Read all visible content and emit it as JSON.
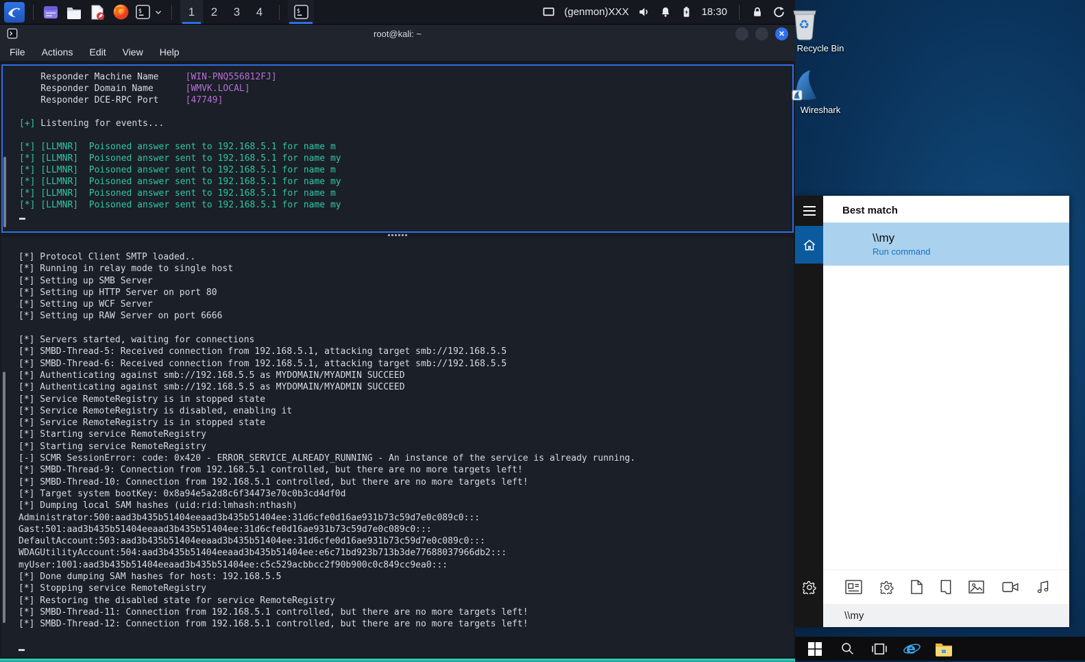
{
  "kali_panel": {
    "launchers": [
      "kali-menu-icon",
      "window-app-icon",
      "file-manager-icon",
      "text-editor-icon",
      "firefox-icon",
      "terminal-icon",
      "chevron-down-icon"
    ],
    "workspaces": {
      "labels": [
        "1",
        "2",
        "3",
        "4"
      ],
      "active_index": 0
    },
    "window_buttons": [
      "terminal-icon"
    ],
    "tray": {
      "genmon_label": "(genmon)XXX",
      "clock": "18:30",
      "icons": [
        "display-icon",
        "volume-icon",
        "bell-icon",
        "battery-icon",
        "lock-icon",
        "logout-icon"
      ]
    }
  },
  "terminal": {
    "title": "root@kali: ~",
    "menu": [
      "File",
      "Actions",
      "Edit",
      "View",
      "Help"
    ],
    "top_pane": {
      "lines": [
        [
          [
            "w",
            "    Responder Machine Name     "
          ],
          [
            "p",
            "[WIN-PNQ556812FJ]"
          ]
        ],
        [
          [
            "w",
            "    Responder Domain Name      "
          ],
          [
            "p",
            "[WMVK.LOCAL]"
          ]
        ],
        [
          [
            "w",
            "    Responder DCE-RPC Port     "
          ],
          [
            "p",
            "[47749]"
          ]
        ],
        [],
        [
          [
            "t",
            "[+]"
          ],
          [
            "w",
            " Listening for events..."
          ]
        ],
        [],
        [
          [
            "t",
            "[*] [LLMNR]  Poisoned answer sent to 192.168.5.1 for name m"
          ]
        ],
        [
          [
            "t",
            "[*] [LLMNR]  Poisoned answer sent to 192.168.5.1 for name my"
          ]
        ],
        [
          [
            "t",
            "[*] [LLMNR]  Poisoned answer sent to 192.168.5.1 for name m"
          ]
        ],
        [
          [
            "t",
            "[*] [LLMNR]  Poisoned answer sent to 192.168.5.1 for name my"
          ]
        ],
        [
          [
            "t",
            "[*] [LLMNR]  Poisoned answer sent to 192.168.5.1 for name m"
          ]
        ],
        [
          [
            "t",
            "[*] [LLMNR]  Poisoned answer sent to 192.168.5.1 for name my"
          ]
        ]
      ]
    },
    "bottom_pane": {
      "lines": [
        "[*] Protocol Client SMTP loaded..",
        "[*] Running in relay mode to single host",
        "[*] Setting up SMB Server",
        "[*] Setting up HTTP Server on port 80",
        "[*] Setting up WCF Server",
        "[*] Setting up RAW Server on port 6666",
        "",
        "[*] Servers started, waiting for connections",
        "[*] SMBD-Thread-5: Received connection from 192.168.5.1, attacking target smb://192.168.5.5",
        "[*] SMBD-Thread-6: Received connection from 192.168.5.1, attacking target smb://192.168.5.5",
        "[*] Authenticating against smb://192.168.5.5 as MYDOMAIN/MYADMIN SUCCEED",
        "[*] Authenticating against smb://192.168.5.5 as MYDOMAIN/MYADMIN SUCCEED",
        "[*] Service RemoteRegistry is in stopped state",
        "[*] Service RemoteRegistry is disabled, enabling it",
        "[*] Service RemoteRegistry is in stopped state",
        "[*] Starting service RemoteRegistry",
        "[*] Starting service RemoteRegistry",
        "[-] SCMR SessionError: code: 0x420 - ERROR_SERVICE_ALREADY_RUNNING - An instance of the service is already running.",
        "[*] SMBD-Thread-9: Connection from 192.168.5.1 controlled, but there are no more targets left!",
        "[*] SMBD-Thread-10: Connection from 192.168.5.1 controlled, but there are no more targets left!",
        "[*] Target system bootKey: 0x8a94e5a2d8c6f34473e70c0b3cd4df0d",
        "[*] Dumping local SAM hashes (uid:rid:lmhash:nthash)",
        "Administrator:500:aad3b435b51404eeaad3b435b51404ee:31d6cfe0d16ae931b73c59d7e0c089c0:::",
        "Gast:501:aad3b435b51404eeaad3b435b51404ee:31d6cfe0d16ae931b73c59d7e0c089c0:::",
        "DefaultAccount:503:aad3b435b51404eeaad3b435b51404ee:31d6cfe0d16ae931b73c59d7e0c089c0:::",
        "WDAGUtilityAccount:504:aad3b435b51404eeaad3b435b51404ee:e6c71bd923b713b3de77688037966db2:::",
        "myUser:1001:aad3b435b51404eeaad3b435b51404ee:c5c529acbbcc2f90b900c0c849cc9ea0:::",
        "[*] Done dumping SAM hashes for host: 192.168.5.5",
        "[*] Stopping service RemoteRegistry",
        "[*] Restoring the disabled state for service RemoteRegistry",
        "[*] SMBD-Thread-11: Connection from 192.168.5.1 controlled, but there are no more targets left!",
        "[*] SMBD-Thread-12: Connection from 192.168.5.1 controlled, but there are no more targets left!"
      ]
    }
  },
  "windows_desktop": {
    "icons": [
      {
        "label": "Recycle Bin",
        "icon": "recycle-bin-icon"
      },
      {
        "label": "Wireshark",
        "icon": "wireshark-icon"
      }
    ],
    "search_panel": {
      "rail_icons": [
        "hamburger-icon",
        "home-icon",
        "gear-icon"
      ],
      "best_match_label": "Best match",
      "result": {
        "title": "\\\\my",
        "subtitle": "Run command"
      },
      "filter_icons": [
        "apps-icon",
        "settings-icon",
        "documents-icon",
        "folders-icon",
        "photos-icon",
        "videos-icon",
        "music-icon"
      ],
      "search_query": "\\\\my"
    },
    "taskbar_icons": [
      "windows-start-icon",
      "search-icon",
      "task-view-icon",
      "edge-icon",
      "file-explorer-icon"
    ]
  },
  "colors": {
    "accent_blue": "#2e6ee7",
    "terminal_teal": "#2fc7a7",
    "terminal_purple": "#b56fd8",
    "highlight_blue": "#aad2ee",
    "run_command_blue": "#1b6fc4",
    "rail_active_blue": "#0c5a9e"
  }
}
